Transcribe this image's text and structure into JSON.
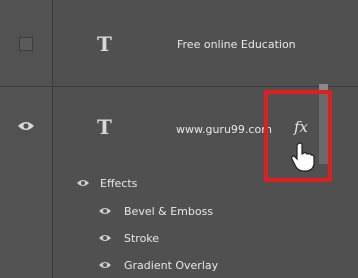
{
  "layers": [
    {
      "name": "Free online Education",
      "visible": false,
      "type_icon": "T"
    },
    {
      "name": "www.guru99.com",
      "visible": true,
      "type_icon": "T",
      "selected": true
    }
  ],
  "effects": {
    "header": "Effects",
    "items": [
      {
        "label": "Bevel & Emboss"
      },
      {
        "label": "Stroke"
      },
      {
        "label": "Gradient Overlay"
      }
    ]
  },
  "fx_label": "fx",
  "colors": {
    "highlight": "#e01e1e",
    "panel": "#505050"
  }
}
